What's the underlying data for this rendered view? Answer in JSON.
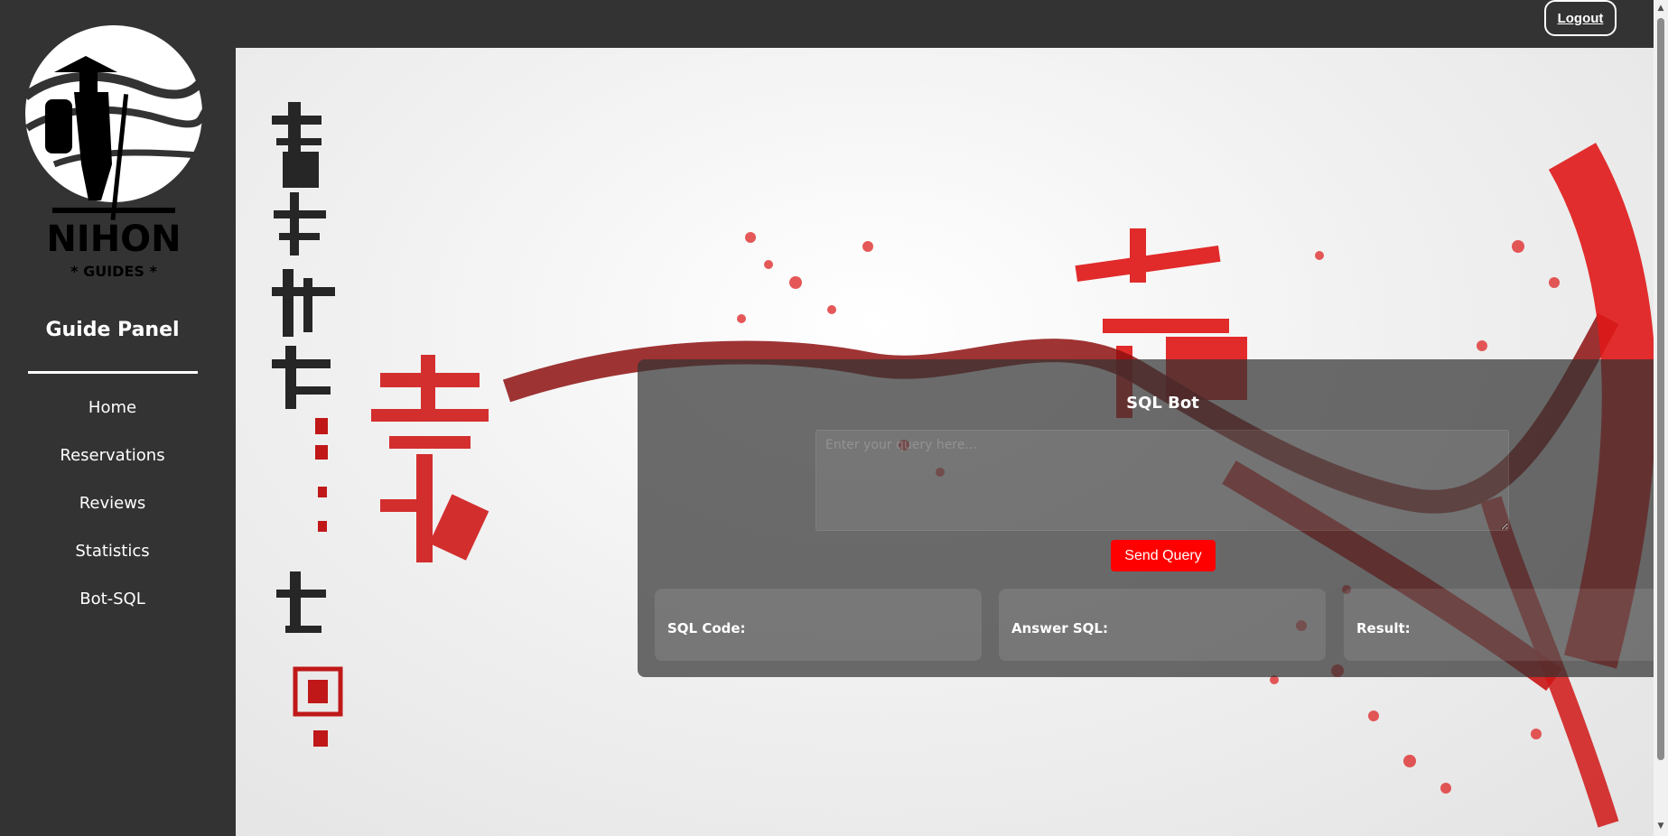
{
  "header": {
    "logout_label": "Logout"
  },
  "sidebar": {
    "logo_text": "NIHON",
    "logo_subtext": "* GUIDES *",
    "title": "Guide Panel",
    "items": [
      {
        "label": "Home"
      },
      {
        "label": "Reservations"
      },
      {
        "label": "Reviews"
      },
      {
        "label": "Statistics"
      },
      {
        "label": "Bot-SQL"
      }
    ]
  },
  "bot": {
    "title": "SQL Bot",
    "query_placeholder": "Enter your query here...",
    "query_value": "",
    "send_label": "Send Query",
    "sql_code_label": "SQL Code:",
    "answer_sql_label": "Answer SQL:",
    "result_label": "Result:"
  },
  "colors": {
    "accent": "#ff0000",
    "sidebar": "#333333",
    "card": "#333333"
  }
}
